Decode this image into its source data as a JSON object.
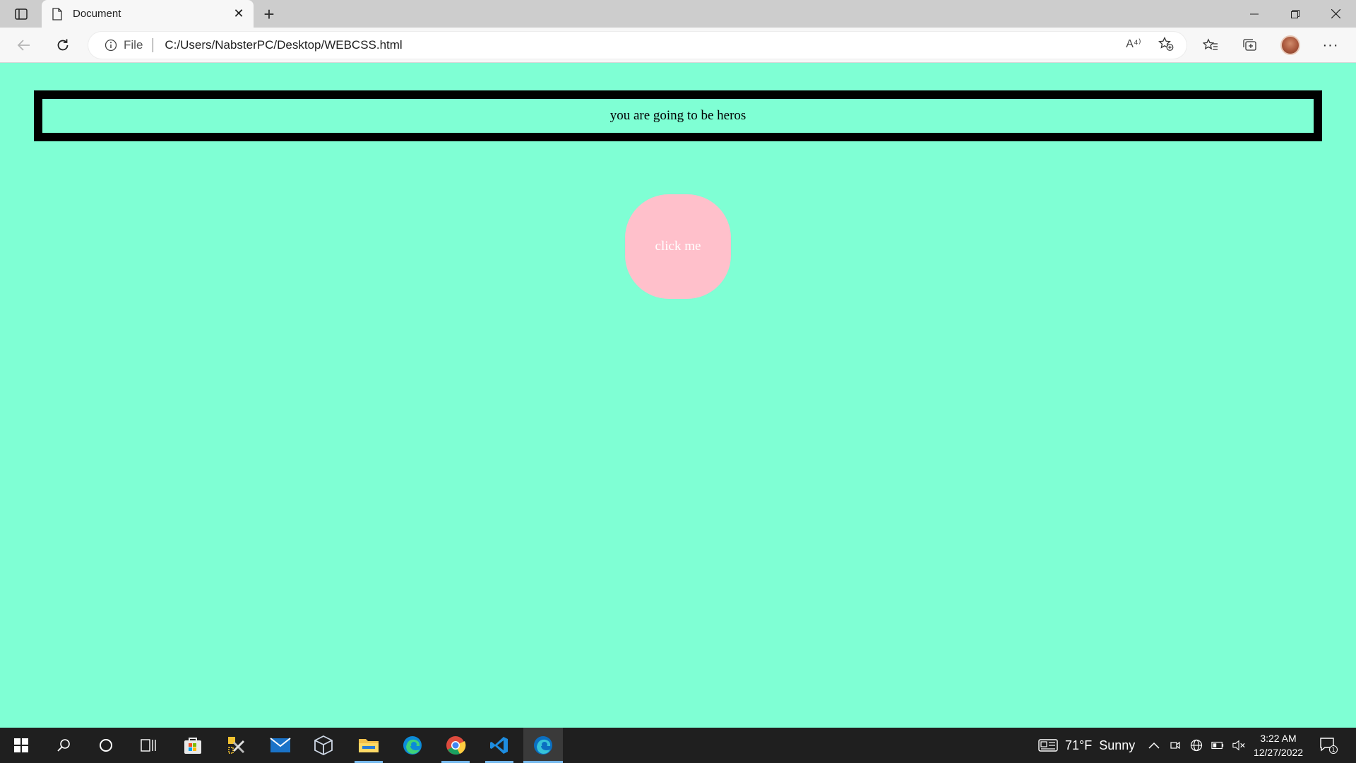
{
  "browser": {
    "tab_title": "Document",
    "address_scheme": "File",
    "url": "C:/Users/NabsterPC/Desktop/WEBCSS.html",
    "read_aloud_glyph": "A⁴⁾"
  },
  "page": {
    "background": "#7fffd4",
    "hero_text": "you are going to be heros",
    "button_label": "click me",
    "button_color": "#ffc0cb"
  },
  "taskbar": {
    "apps": [
      "start-icon",
      "search-icon",
      "cortana-icon",
      "task-view-icon",
      "store-icon",
      "tools-icon",
      "mail-icon",
      "virtualbox-icon",
      "file-explorer-icon",
      "edge-icon",
      "chrome-icon",
      "vscode-icon",
      "edge-dev-icon"
    ],
    "weather_temp": "71°F",
    "weather_desc": "Sunny",
    "time": "3:22 AM",
    "date": "12/27/2022",
    "notification_count": "1"
  }
}
